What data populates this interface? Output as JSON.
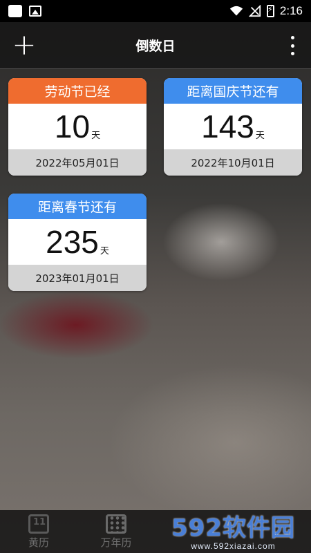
{
  "status_bar": {
    "time": "2:16"
  },
  "toolbar": {
    "title": "倒数日"
  },
  "cards": [
    {
      "header": "劳动节已经",
      "header_color": "#ef6c2f",
      "days": "10",
      "unit": "天",
      "date": "2022年05月01日"
    },
    {
      "header": "距离国庆节还有",
      "header_color": "#3f8ded",
      "days": "143",
      "unit": "天",
      "date": "2022年10月01日"
    },
    {
      "header": "距离春节还有",
      "header_color": "#3f8ded",
      "days": "235",
      "unit": "天",
      "date": "2023年01月01日"
    }
  ],
  "bottom_nav": [
    {
      "label": "黄历",
      "icon": "calendar-day-icon"
    },
    {
      "label": "万年历",
      "icon": "calendar-grid-icon"
    }
  ],
  "watermark": {
    "logo": "592软件园",
    "url": "www.592xiazai.com"
  }
}
